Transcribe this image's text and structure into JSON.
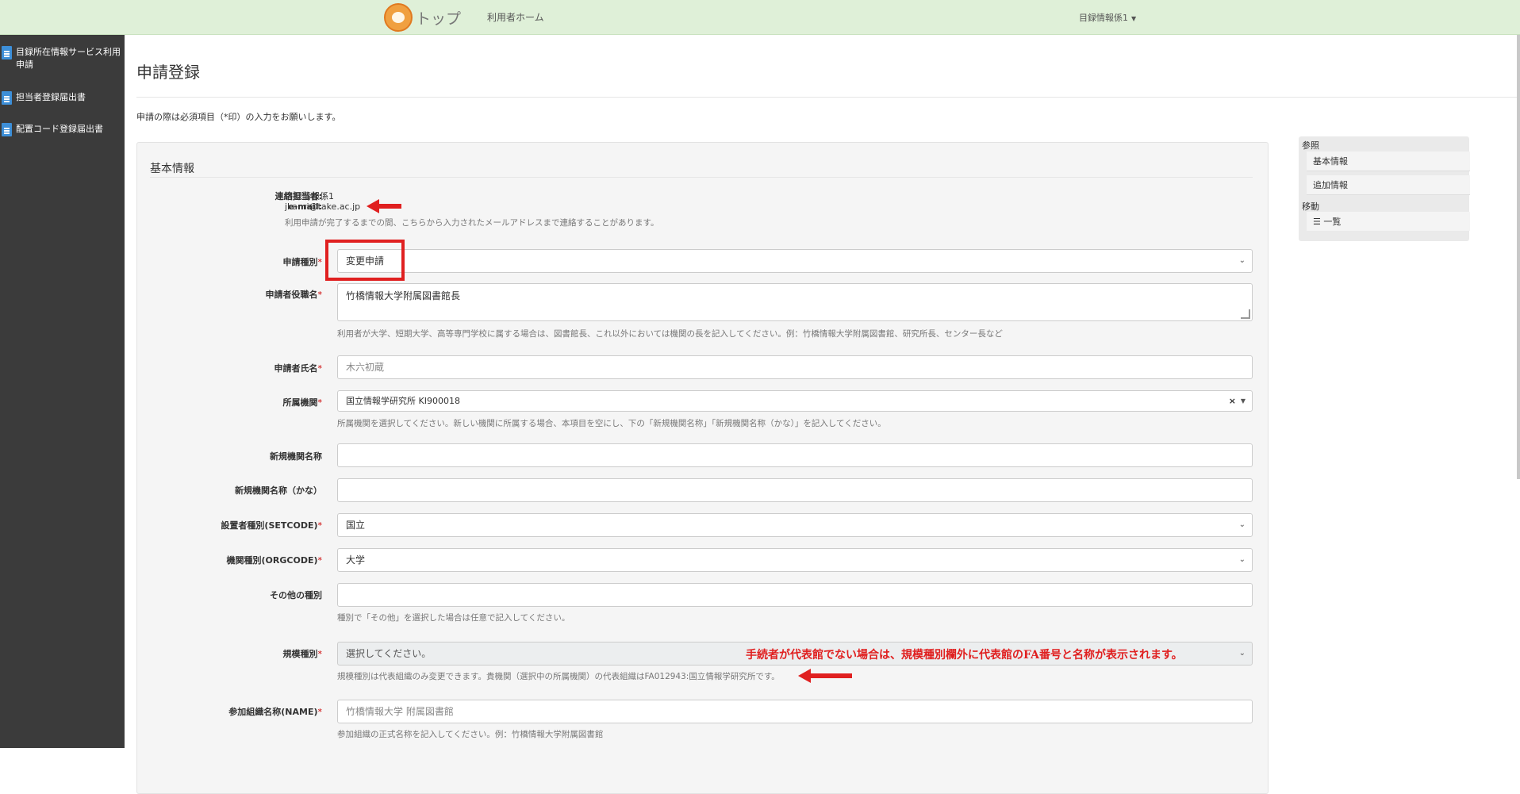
{
  "header": {
    "brand": "トップ",
    "home_link": "利用者ホーム",
    "user_menu": "目録情報係1"
  },
  "sidebar": {
    "items": [
      {
        "label": "目録所在情報サービス利用申請"
      },
      {
        "label": "担当者登録届出書"
      },
      {
        "label": "配置コード登録届出書"
      }
    ]
  },
  "page": {
    "title": "申請登録",
    "notice": "申請の際は必須項目（*印）の入力をお願いします。"
  },
  "form": {
    "section_title": "基本情報",
    "contact_label": "連絡担当者:",
    "contact_value": "目録情報係1",
    "email_label": "e-mail:",
    "email_value": "jkanri@take.ac.jp",
    "email_help": "利用申請が完了するまでの間、こちらから入力されたメールアドレスまで連絡することがあります。",
    "required_mark": "*",
    "fields": {
      "app_type": {
        "label": "申請種別",
        "value": "変更申請"
      },
      "applicant_title": {
        "label": "申請者役職名",
        "value": "竹橋情報大学附属図書館長",
        "help": "利用者が大学、短期大学、高等専門学校に属する場合は、図書館長、これ以外においては機関の長を記入してください。例：竹橋情報大学附属図書館、研究所長、センター長など"
      },
      "applicant_name": {
        "label": "申請者氏名",
        "placeholder": "木六初蔵"
      },
      "org": {
        "label": "所属機関",
        "value": "国立情報学研究所 KI900018",
        "help": "所属機関を選択してください。新しい機関に所属する場合、本項目を空にし、下の「新規機関名称」「新規機関名称（かな）」を記入してください。"
      },
      "new_org_name": {
        "label": "新規機関名称",
        "value": ""
      },
      "new_org_kana": {
        "label": "新規機関名称（かな）",
        "value": ""
      },
      "setcode": {
        "label": "設置者種別(SETCODE)",
        "value": "国立"
      },
      "orgcode": {
        "label": "機関種別(ORGCODE)",
        "value": "大学"
      },
      "other_type": {
        "label": "その他の種別",
        "value": "",
        "help": "種別で「その他」を選択した場合は任意で記入してください。"
      },
      "scale": {
        "label": "規模種別",
        "value": "選択してください。",
        "help": "規模種別は代表組織のみ変更できます。貴機関（選択中の所属機関）の代表組織はFA012943:国立情報学研究所です。"
      },
      "name": {
        "label": "参加組織名称(NAME)",
        "placeholder": "竹橋情報大学 附属図書館",
        "help": "参加組織の正式名称を記入してください。例：竹橋情報大学附属図書館"
      }
    }
  },
  "annotation": {
    "text": "手続者が代表館でない場合は、規模種別欄外に代表館のFA番号と名称が表示されます。"
  },
  "reference": {
    "ref_head": "参照",
    "ref_items": [
      "基本情報",
      "追加情報"
    ],
    "move_head": "移動",
    "move_items": [
      "☰ 一覧"
    ]
  },
  "colors": {
    "topbar": "#dff0d8",
    "sidebar": "#3b3b3b",
    "annotation": "#e02020",
    "required": "#cc0000"
  },
  "icons": {
    "sidebar": "document-icon",
    "select": "chevron-down-icon",
    "clear": "close-icon"
  }
}
